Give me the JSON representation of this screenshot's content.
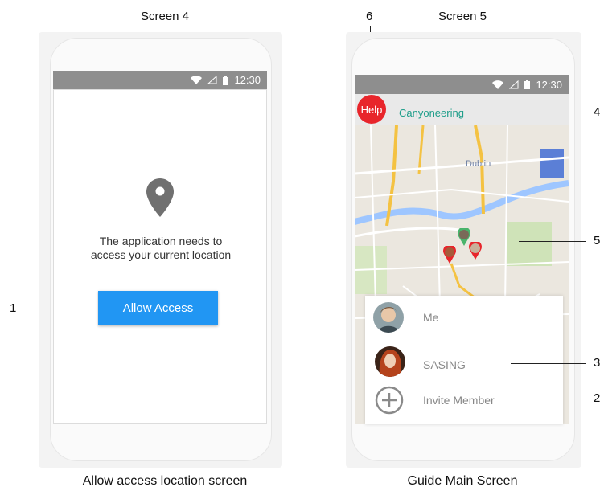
{
  "screen4": {
    "title": "Screen 4",
    "status_time": "12:30",
    "message": "The application needs to access your current location",
    "allow_button": "Allow Access",
    "caption": "Allow access location screen",
    "callout_1": "1"
  },
  "screen5": {
    "title": "Screen 5",
    "status_time": "12:30",
    "help_button": "Help",
    "activity_title": "Canyoneering",
    "map_city_label": "Dublin",
    "members": [
      {
        "name": "Me"
      },
      {
        "name": "SASING"
      }
    ],
    "invite_label": "Invite Member",
    "caption": "Guide Main Screen",
    "callouts": {
      "c6": "6",
      "c4": "4",
      "c5": "5",
      "c3": "3",
      "c2": "2"
    }
  },
  "colors": {
    "accent_blue": "#2196f3",
    "help_red": "#e8252b",
    "activity_green": "#1f9e8a",
    "statusbar_gray": "#8e8e8e"
  }
}
